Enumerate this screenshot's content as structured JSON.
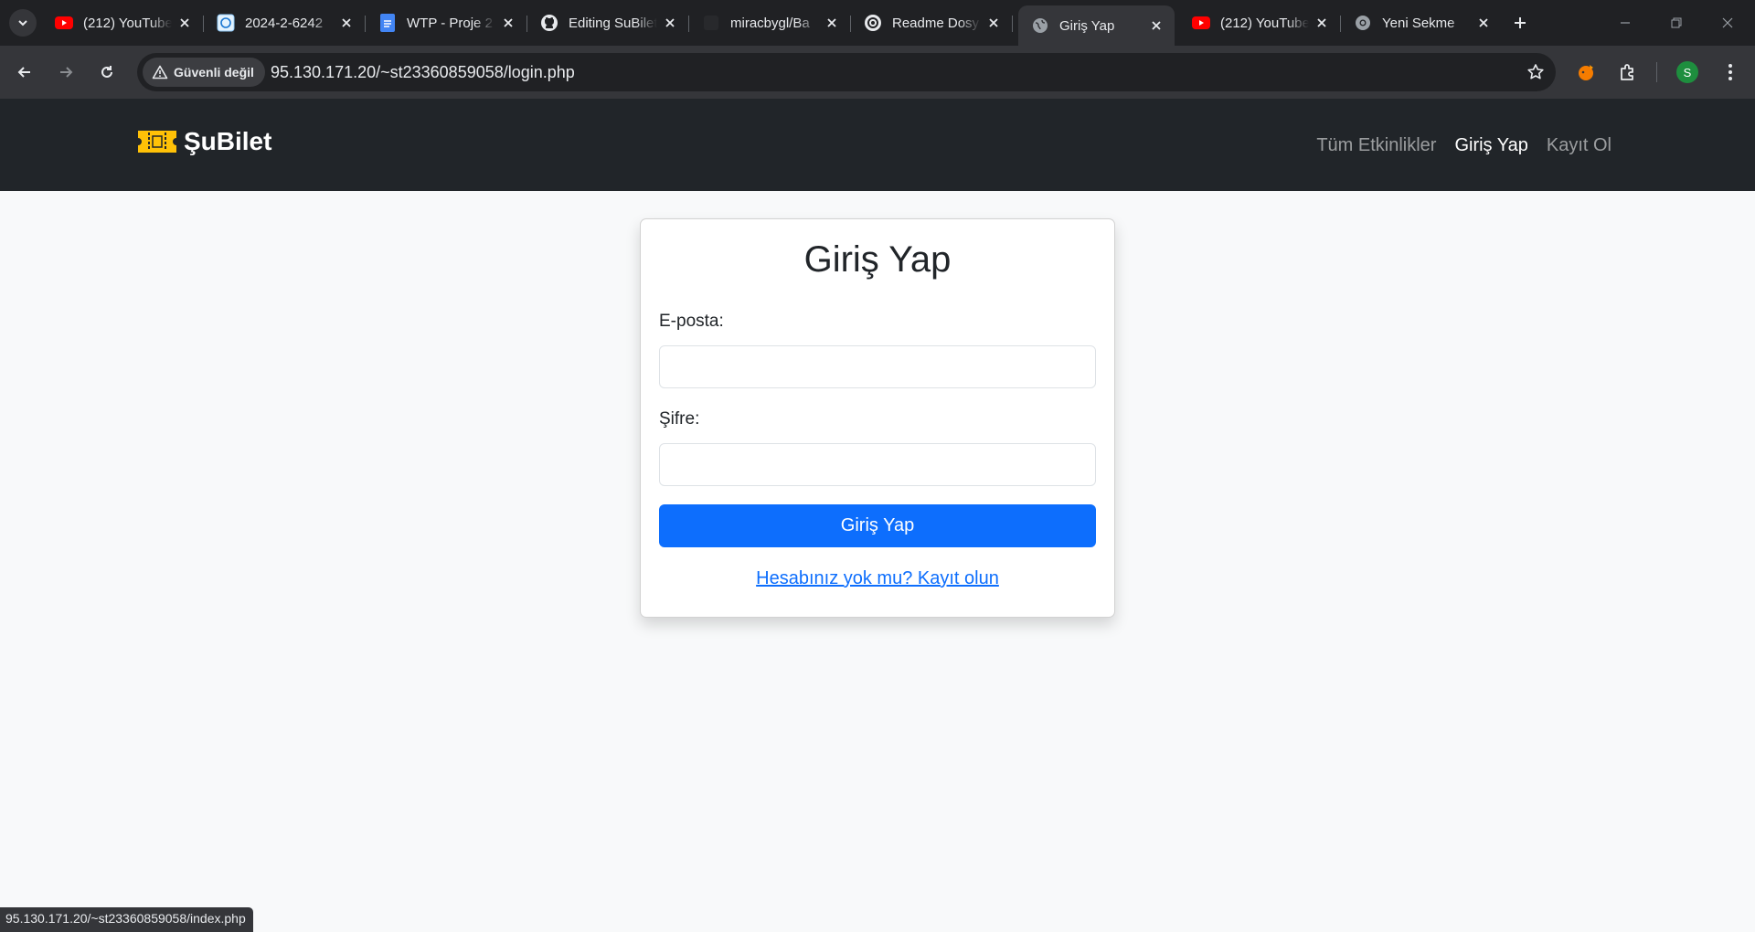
{
  "browser": {
    "tabs": [
      {
        "title": "(212) YouTube",
        "icon": "youtube-icon",
        "active": false
      },
      {
        "title": "2024-2-6242",
        "icon": "university-icon",
        "active": false
      },
      {
        "title": "WTP - Proje 2",
        "icon": "google-docs-icon",
        "active": false
      },
      {
        "title": "Editing SuBilet",
        "icon": "github-icon",
        "active": false
      },
      {
        "title": "miracbygl/Ba",
        "icon": "blank-icon",
        "active": false
      },
      {
        "title": "Readme Dosy",
        "icon": "chatgpt-icon",
        "active": false
      },
      {
        "title": "Giriş Yap",
        "icon": "globe-icon",
        "active": true
      },
      {
        "title": "(212) YouTube",
        "icon": "youtube-icon",
        "active": false
      },
      {
        "title": "Yeni Sekme",
        "icon": "chrome-icon",
        "active": false
      }
    ],
    "security_label": "Güvenli değil",
    "url": "95.130.171.20/~st23360859058/login.php",
    "profile_initial": "S",
    "status_url": "95.130.171.20/~st23360859058/index.php",
    "colors": {
      "tabbar": "#202124",
      "toolbar": "#35363a"
    }
  },
  "site": {
    "brand": "ŞuBilet",
    "brand_icon": "ticket-icon",
    "nav": {
      "all_events": "Tüm Etkinlikler",
      "login": "Giriş Yap",
      "register": "Kayıt Ol"
    },
    "colors": {
      "navbar": "#212529",
      "primary": "#0d6efd",
      "page_bg": "#f8f9fa"
    }
  },
  "login": {
    "title": "Giriş Yap",
    "email_label": "E-posta:",
    "email_value": "",
    "password_label": "Şifre:",
    "password_value": "",
    "submit_label": "Giriş Yap",
    "register_link": "Hesabınız yok mu? Kayıt olun"
  }
}
